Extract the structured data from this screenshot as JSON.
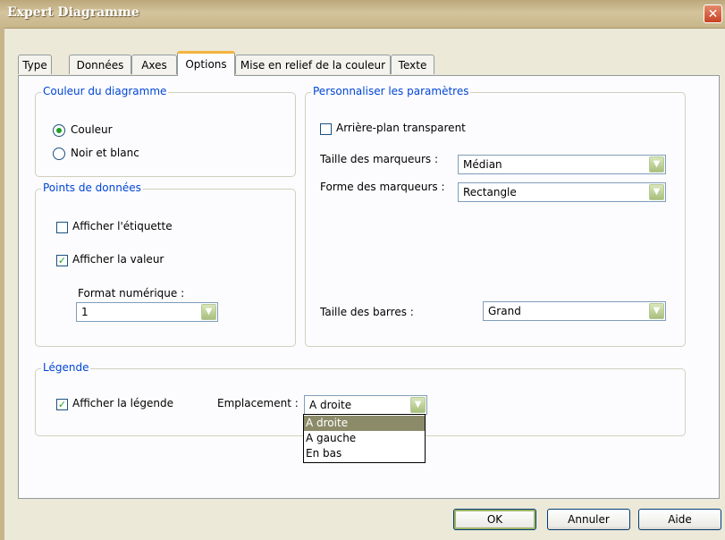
{
  "window": {
    "title": "Expert Diagramme",
    "close_glyph": "✕"
  },
  "tabs": [
    {
      "label": "Type"
    },
    {
      "label": "Données"
    },
    {
      "label": "Axes"
    },
    {
      "label": "Options",
      "active": true
    },
    {
      "label": "Mise en relief de la couleur"
    },
    {
      "label": "Texte"
    }
  ],
  "color_group": {
    "title": "Couleur du diagramme",
    "option_color": "Couleur",
    "option_bw": "Noir et blanc",
    "selected": "Couleur"
  },
  "data_points_group": {
    "title": "Points de données",
    "show_label": "Afficher l'étiquette",
    "show_label_checked": false,
    "show_value": "Afficher la valeur",
    "show_value_checked": true,
    "number_format_label": "Format numérique :",
    "number_format_value": "1"
  },
  "custom_group": {
    "title": "Personnaliser les paramètres",
    "transparent_bg": "Arrière-plan transparent",
    "transparent_bg_checked": false,
    "marker_size_label": "Taille des marqueurs :",
    "marker_size_value": "Médian",
    "marker_shape_label": "Forme des marqueurs :",
    "marker_shape_value": "Rectangle",
    "bar_size_label": "Taille des barres :",
    "bar_size_value": "Grand"
  },
  "legend_group": {
    "title": "Légende",
    "show_legend": "Afficher la légende",
    "show_legend_checked": true,
    "placement_label": "Emplacement :",
    "placement_value": "A droite",
    "placement_options": [
      "A droite",
      "A gauche",
      "En bas"
    ]
  },
  "buttons": {
    "ok": "OK",
    "cancel": "Annuler",
    "help": "Aide"
  },
  "colors": {
    "legend_text": "#0046d5",
    "check_green": "#21a121",
    "active_tab_accent": "#f3b43f"
  }
}
